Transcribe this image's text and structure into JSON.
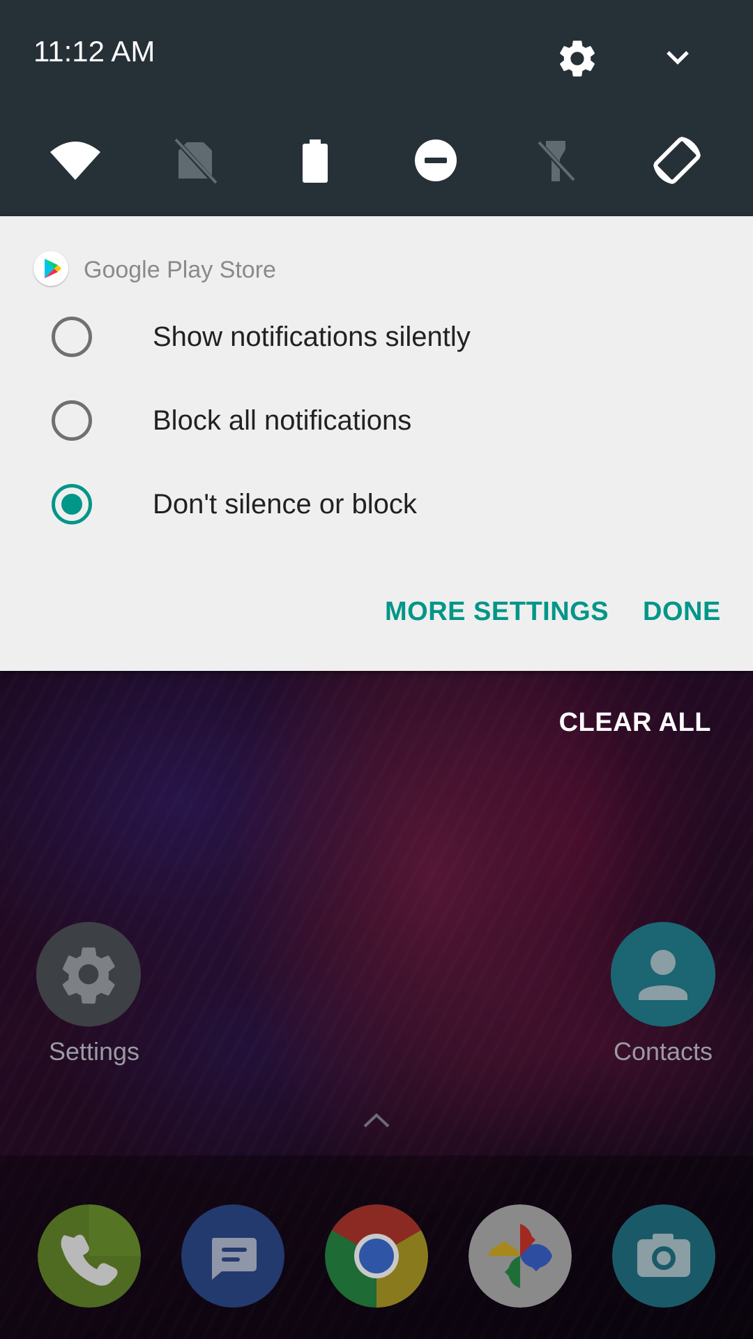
{
  "status": {
    "time": "11:12 AM"
  },
  "quick_settings": {
    "header_icons": [
      "gear-icon",
      "chevron-down-icon"
    ],
    "tiles": [
      "wifi-icon",
      "no-sim-icon",
      "battery-icon",
      "do-not-disturb-icon",
      "flashlight-off-icon",
      "auto-rotate-icon"
    ]
  },
  "notification": {
    "app_name": "Google Play Store",
    "options": [
      {
        "label": "Show notifications silently",
        "selected": false
      },
      {
        "label": "Block all notifications",
        "selected": false
      },
      {
        "label": "Don't silence or block",
        "selected": true
      }
    ],
    "more_settings_label": "MORE SETTINGS",
    "done_label": "DONE"
  },
  "home": {
    "clear_all_label": "CLEAR ALL",
    "apps": [
      {
        "label": "Settings",
        "icon": "gear-icon"
      },
      {
        "label": "Contacts",
        "icon": "person-icon"
      }
    ],
    "dock": [
      "phone-icon",
      "messages-icon",
      "chrome-icon",
      "photos-icon",
      "camera-icon"
    ]
  },
  "colors": {
    "accent": "#009688",
    "header_bg": "#263037",
    "card_bg": "#efefef"
  }
}
